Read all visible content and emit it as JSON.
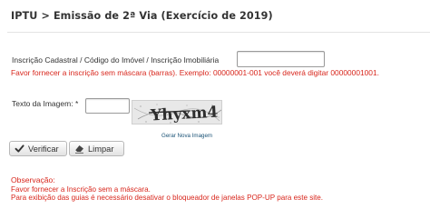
{
  "header": {
    "title": "IPTU > Emissão de 2ª Via (Exercício de 2019)"
  },
  "form": {
    "inscricao": {
      "label": "Inscrição Cadastral / Código do Imóvel / Inscrição Imobiliária",
      "value": "",
      "error": "Favor fornecer a inscrição sem máscara (barras). Exemplo: 00000001-001 você deverá digitar 00000001001."
    },
    "captcha": {
      "label": "Texto da Imagem:",
      "required_mark": "*",
      "value": "",
      "image_text": "Yhyxm4",
      "refresh_link": "Gerar Nova Imagem"
    },
    "buttons": {
      "verify_label": "Verificar",
      "clear_label": "Limpar"
    }
  },
  "notes": {
    "title": "Observação:",
    "lines": [
      "Favor fornecer a Inscrição sem a máscara.",
      "Para exibição das guias é necessário desativar o bloqueador de janelas POP-UP para este site."
    ]
  },
  "colors": {
    "error_text": "#d8261c",
    "link": "#1a5276",
    "title_text": "#333333"
  },
  "icons": {
    "verify": "checkmark-icon",
    "clear": "eraser-icon"
  }
}
